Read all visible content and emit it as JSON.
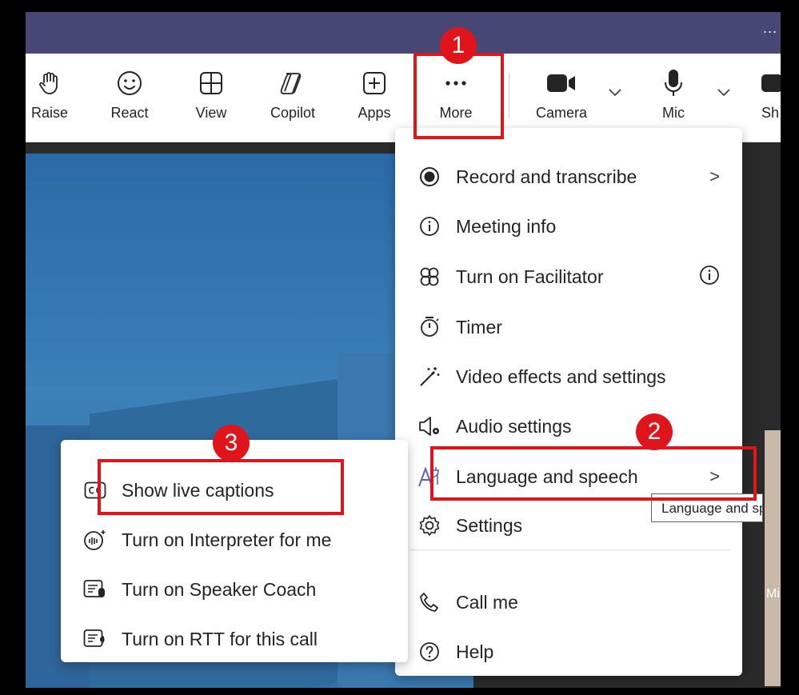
{
  "title_bar": {
    "overflow_label": "..."
  },
  "toolbar": {
    "buttons": [
      {
        "label": "Raise",
        "icon": "hand-icon"
      },
      {
        "label": "React",
        "icon": "smiley-icon"
      },
      {
        "label": "View",
        "icon": "grid-icon"
      },
      {
        "label": "Copilot",
        "icon": "copilot-icon"
      },
      {
        "label": "Apps",
        "icon": "plus-square-icon"
      },
      {
        "label": "More",
        "icon": "ellipsis-icon"
      },
      {
        "label": "Camera",
        "icon": "camera-icon"
      },
      {
        "label": "Mic",
        "icon": "mic-icon"
      },
      {
        "label": "Sh",
        "icon": "share-icon"
      }
    ]
  },
  "more_menu": {
    "items": [
      {
        "label": "Record and transcribe",
        "icon": "record-icon",
        "has_submenu": true
      },
      {
        "label": "Meeting info",
        "icon": "info-icon"
      },
      {
        "label": "Turn on Facilitator",
        "icon": "facilitator-icon",
        "has_info": true
      },
      {
        "label": "Timer",
        "icon": "timer-icon"
      },
      {
        "label": "Video effects and settings",
        "icon": "magic-wand-icon"
      },
      {
        "label": "Audio settings",
        "icon": "speaker-gear-icon"
      },
      {
        "label": "Language and speech",
        "icon": "language-icon",
        "has_submenu": true,
        "highlighted": true
      },
      {
        "label": "Settings",
        "icon": "gear-icon"
      },
      {
        "label": "Call me",
        "icon": "phone-icon"
      },
      {
        "label": "Help",
        "icon": "help-icon"
      }
    ],
    "submenu_chevron": ">"
  },
  "language_submenu": {
    "items": [
      {
        "label": "Show live captions",
        "icon": "cc-icon"
      },
      {
        "label": "Turn on Interpreter for me",
        "icon": "interpreter-icon"
      },
      {
        "label": "Turn on Speaker Coach",
        "icon": "speaker-coach-icon"
      },
      {
        "label": "Turn on RTT for this call",
        "icon": "rtt-icon"
      }
    ]
  },
  "tooltip": {
    "text": "Language and speech"
  },
  "annotations": {
    "step1": "1",
    "step2": "2",
    "step3": "3"
  },
  "thumbnail_fragment": {
    "text": "Mi"
  },
  "colors": {
    "title_bar": "#464775",
    "annotation_red": "#e0141b",
    "accent": "#5b5fc7"
  }
}
